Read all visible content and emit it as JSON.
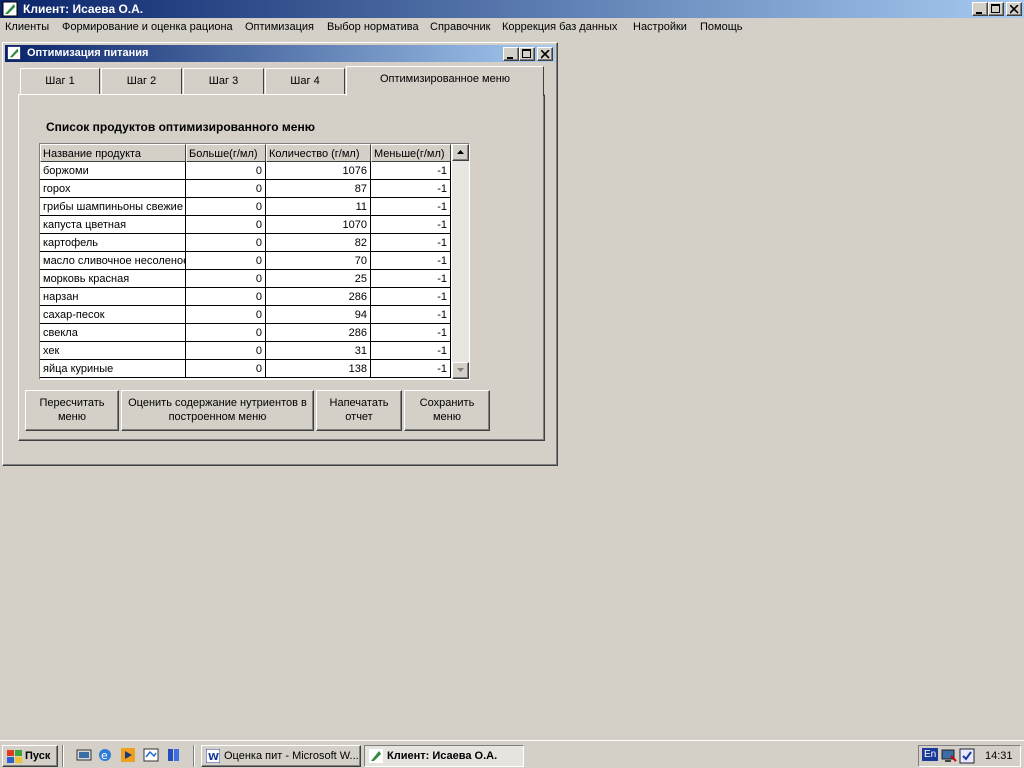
{
  "app": {
    "title": "Клиент: Исаева О.А.",
    "colors": {
      "titlebar": "#0a246a",
      "titlebar_end": "#a6caf0",
      "face": "#d4d0c8"
    }
  },
  "menu": {
    "items": [
      "Клиенты",
      "Формирование и оценка рациона",
      "Оптимизация",
      "Выбор норматива",
      "Справочник",
      "Коррекция  баз данных",
      "Настройки",
      "Помощь"
    ]
  },
  "window": {
    "title": "Оптимизация питания",
    "tabs": [
      "Шаг 1",
      "Шаг 2",
      "Шаг 3",
      "Шаг 4",
      "Оптимизированное меню"
    ],
    "active_tab": "Оптимизированное меню"
  },
  "list": {
    "title": "Список продуктов оптимизированного меню",
    "columns": [
      "Название продукта",
      "Больше(г/мл)",
      "Количество (г/мл)",
      "Меньше(г/мл)"
    ],
    "rows": [
      [
        "боржоми",
        "0",
        "1076",
        "-1"
      ],
      [
        "горох",
        "0",
        "87",
        "-1"
      ],
      [
        "грибы шампиньоны свежие",
        "0",
        "11",
        "-1"
      ],
      [
        "капуста цветная",
        "0",
        "1070",
        "-1"
      ],
      [
        "картофель",
        "0",
        "82",
        "-1"
      ],
      [
        "масло сливочное несоленое",
        "0",
        "70",
        "-1"
      ],
      [
        "морковь красная",
        "0",
        "25",
        "-1"
      ],
      [
        "нарзан",
        "0",
        "286",
        "-1"
      ],
      [
        "сахар-песок",
        "0",
        "94",
        "-1"
      ],
      [
        "свекла",
        "0",
        "286",
        "-1"
      ],
      [
        "хек",
        "0",
        "31",
        "-1"
      ],
      [
        "яйца куриные",
        "0",
        "138",
        "-1"
      ]
    ]
  },
  "buttons": {
    "recalc": "Пересчитать меню",
    "evaluate": "Оценить содержание нутриентов в построенном меню",
    "print": "Напечатать отчет",
    "save": "Сохранить меню"
  },
  "taskbar": {
    "start": "Пуск",
    "tasks": [
      "Оценка пит - Microsoft W...",
      "Клиент: Исаева О.А."
    ],
    "lang": "En",
    "clock": "14:31"
  }
}
